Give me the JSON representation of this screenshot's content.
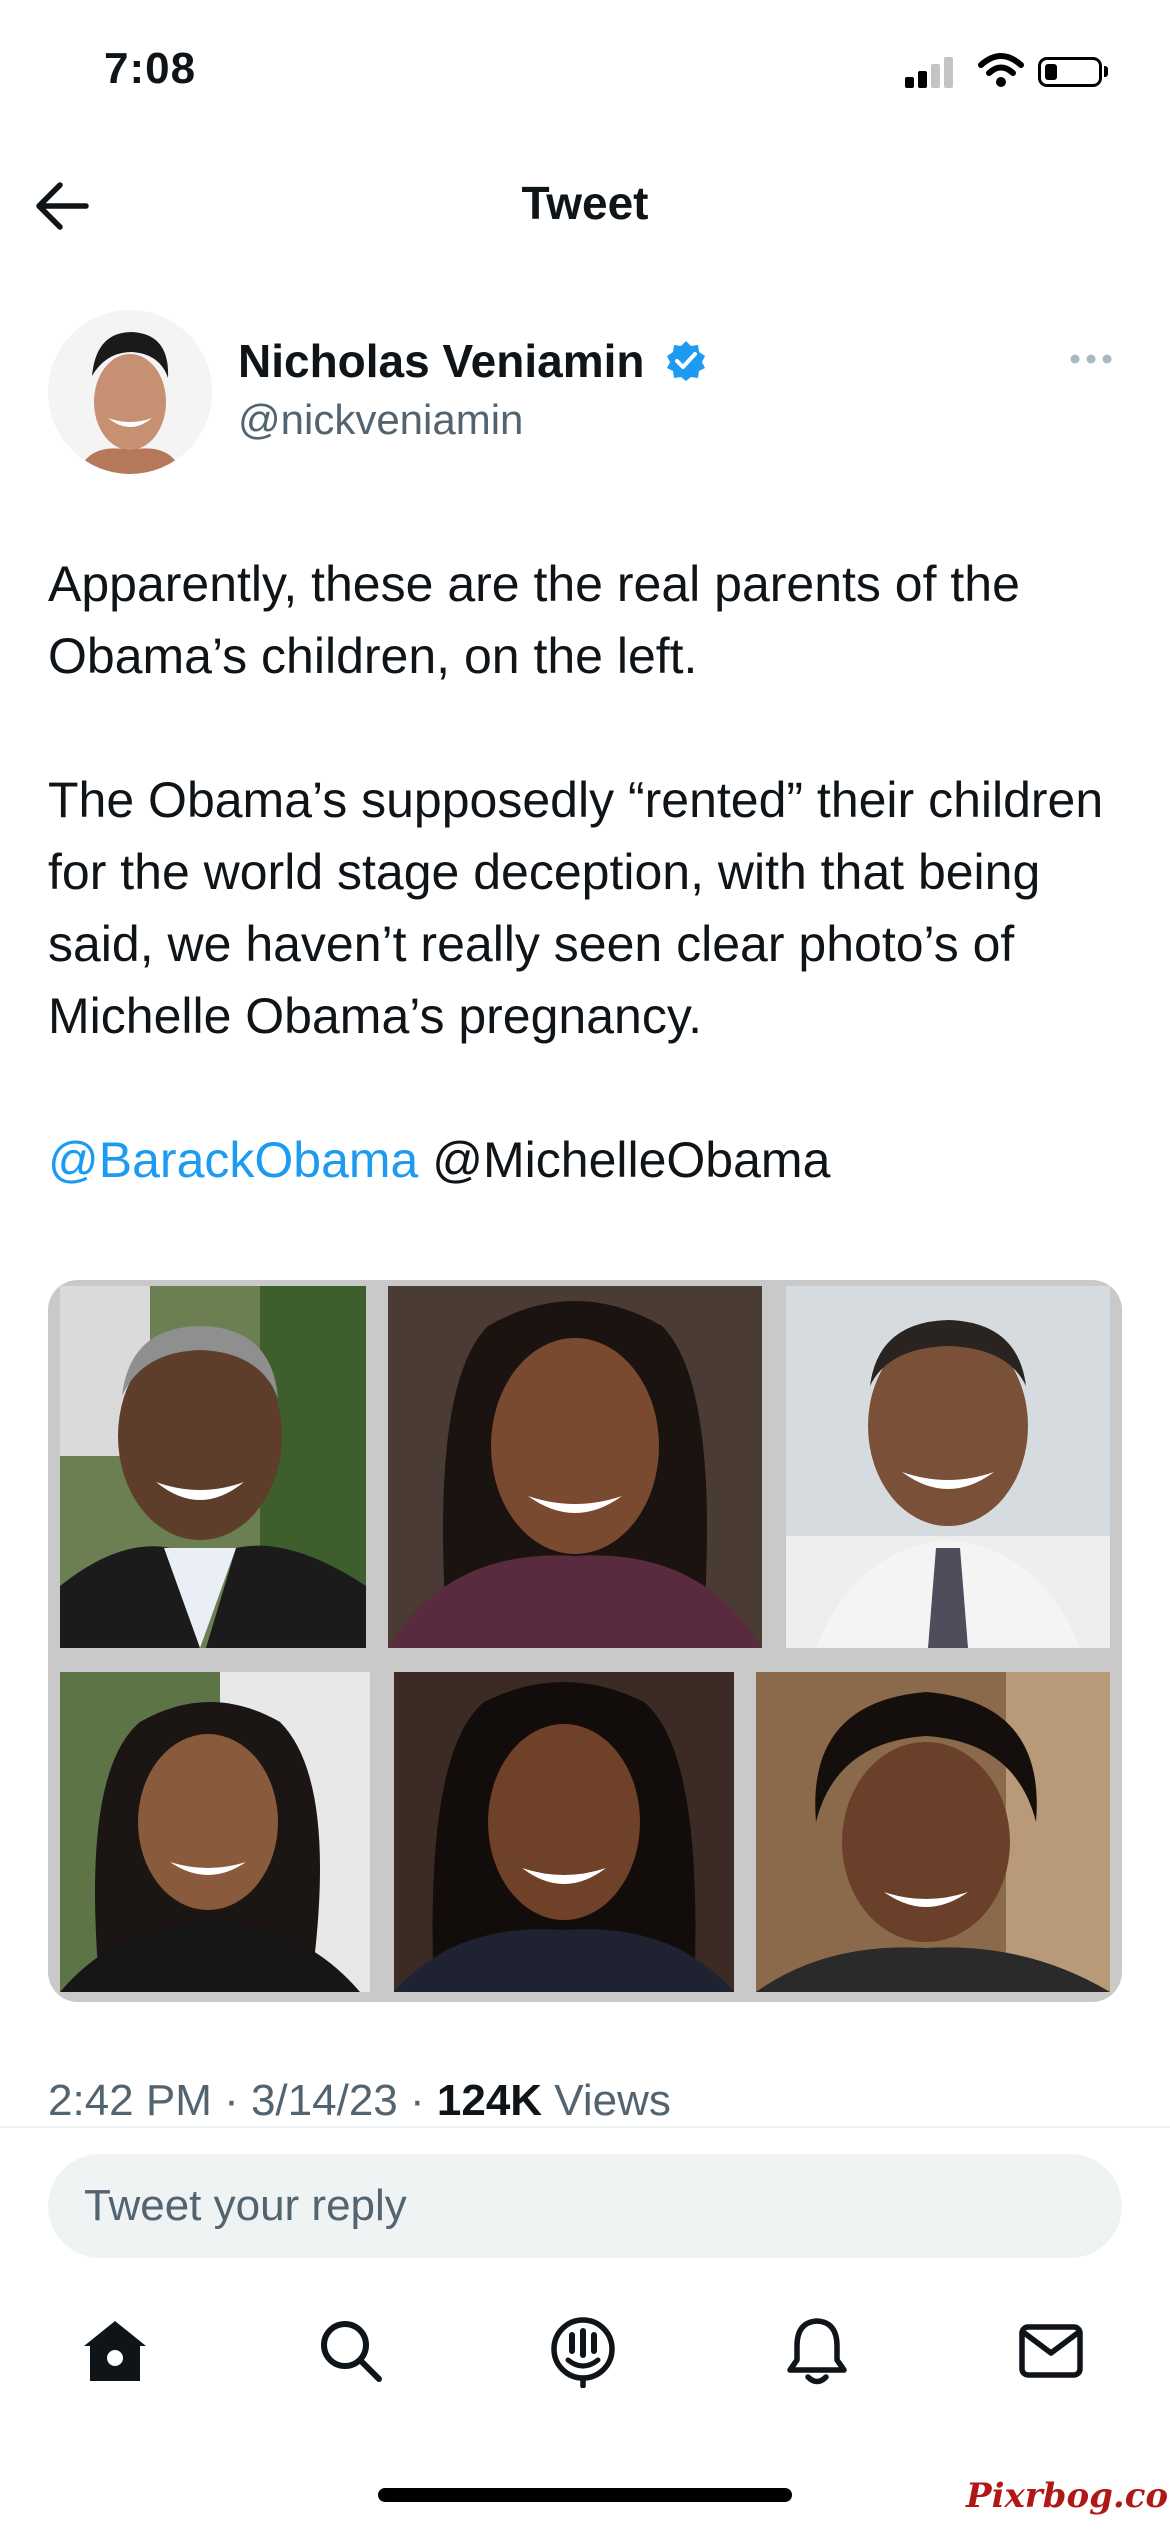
{
  "status_bar": {
    "time": "7:08"
  },
  "header": {
    "title": "Tweet"
  },
  "tweet": {
    "author": {
      "name": "Nicholas Veniamin",
      "handle": "@nickveniamin"
    },
    "text_p1": "Apparently, these are the real parents of the Obama’s children, on the left.",
    "text_p2": "The Obama’s supposedly “rented” their children for the world stage deception, with that being said, we haven’t really seen clear photo’s of Michelle Obama’s pregnancy.",
    "mentions": [
      "@BarackObama",
      "@MichelleObama"
    ],
    "timestamp": "2:42 PM · 3/14/23 · ",
    "views_count": "124K",
    "views_label": " Views"
  },
  "reply": {
    "placeholder": "Tweet your reply"
  },
  "watermark": "Pixrbog.com",
  "colors": {
    "link": "#1d9bf0",
    "verified": "#1d9bf0",
    "text": "#0f1419",
    "secondary": "#536471"
  }
}
